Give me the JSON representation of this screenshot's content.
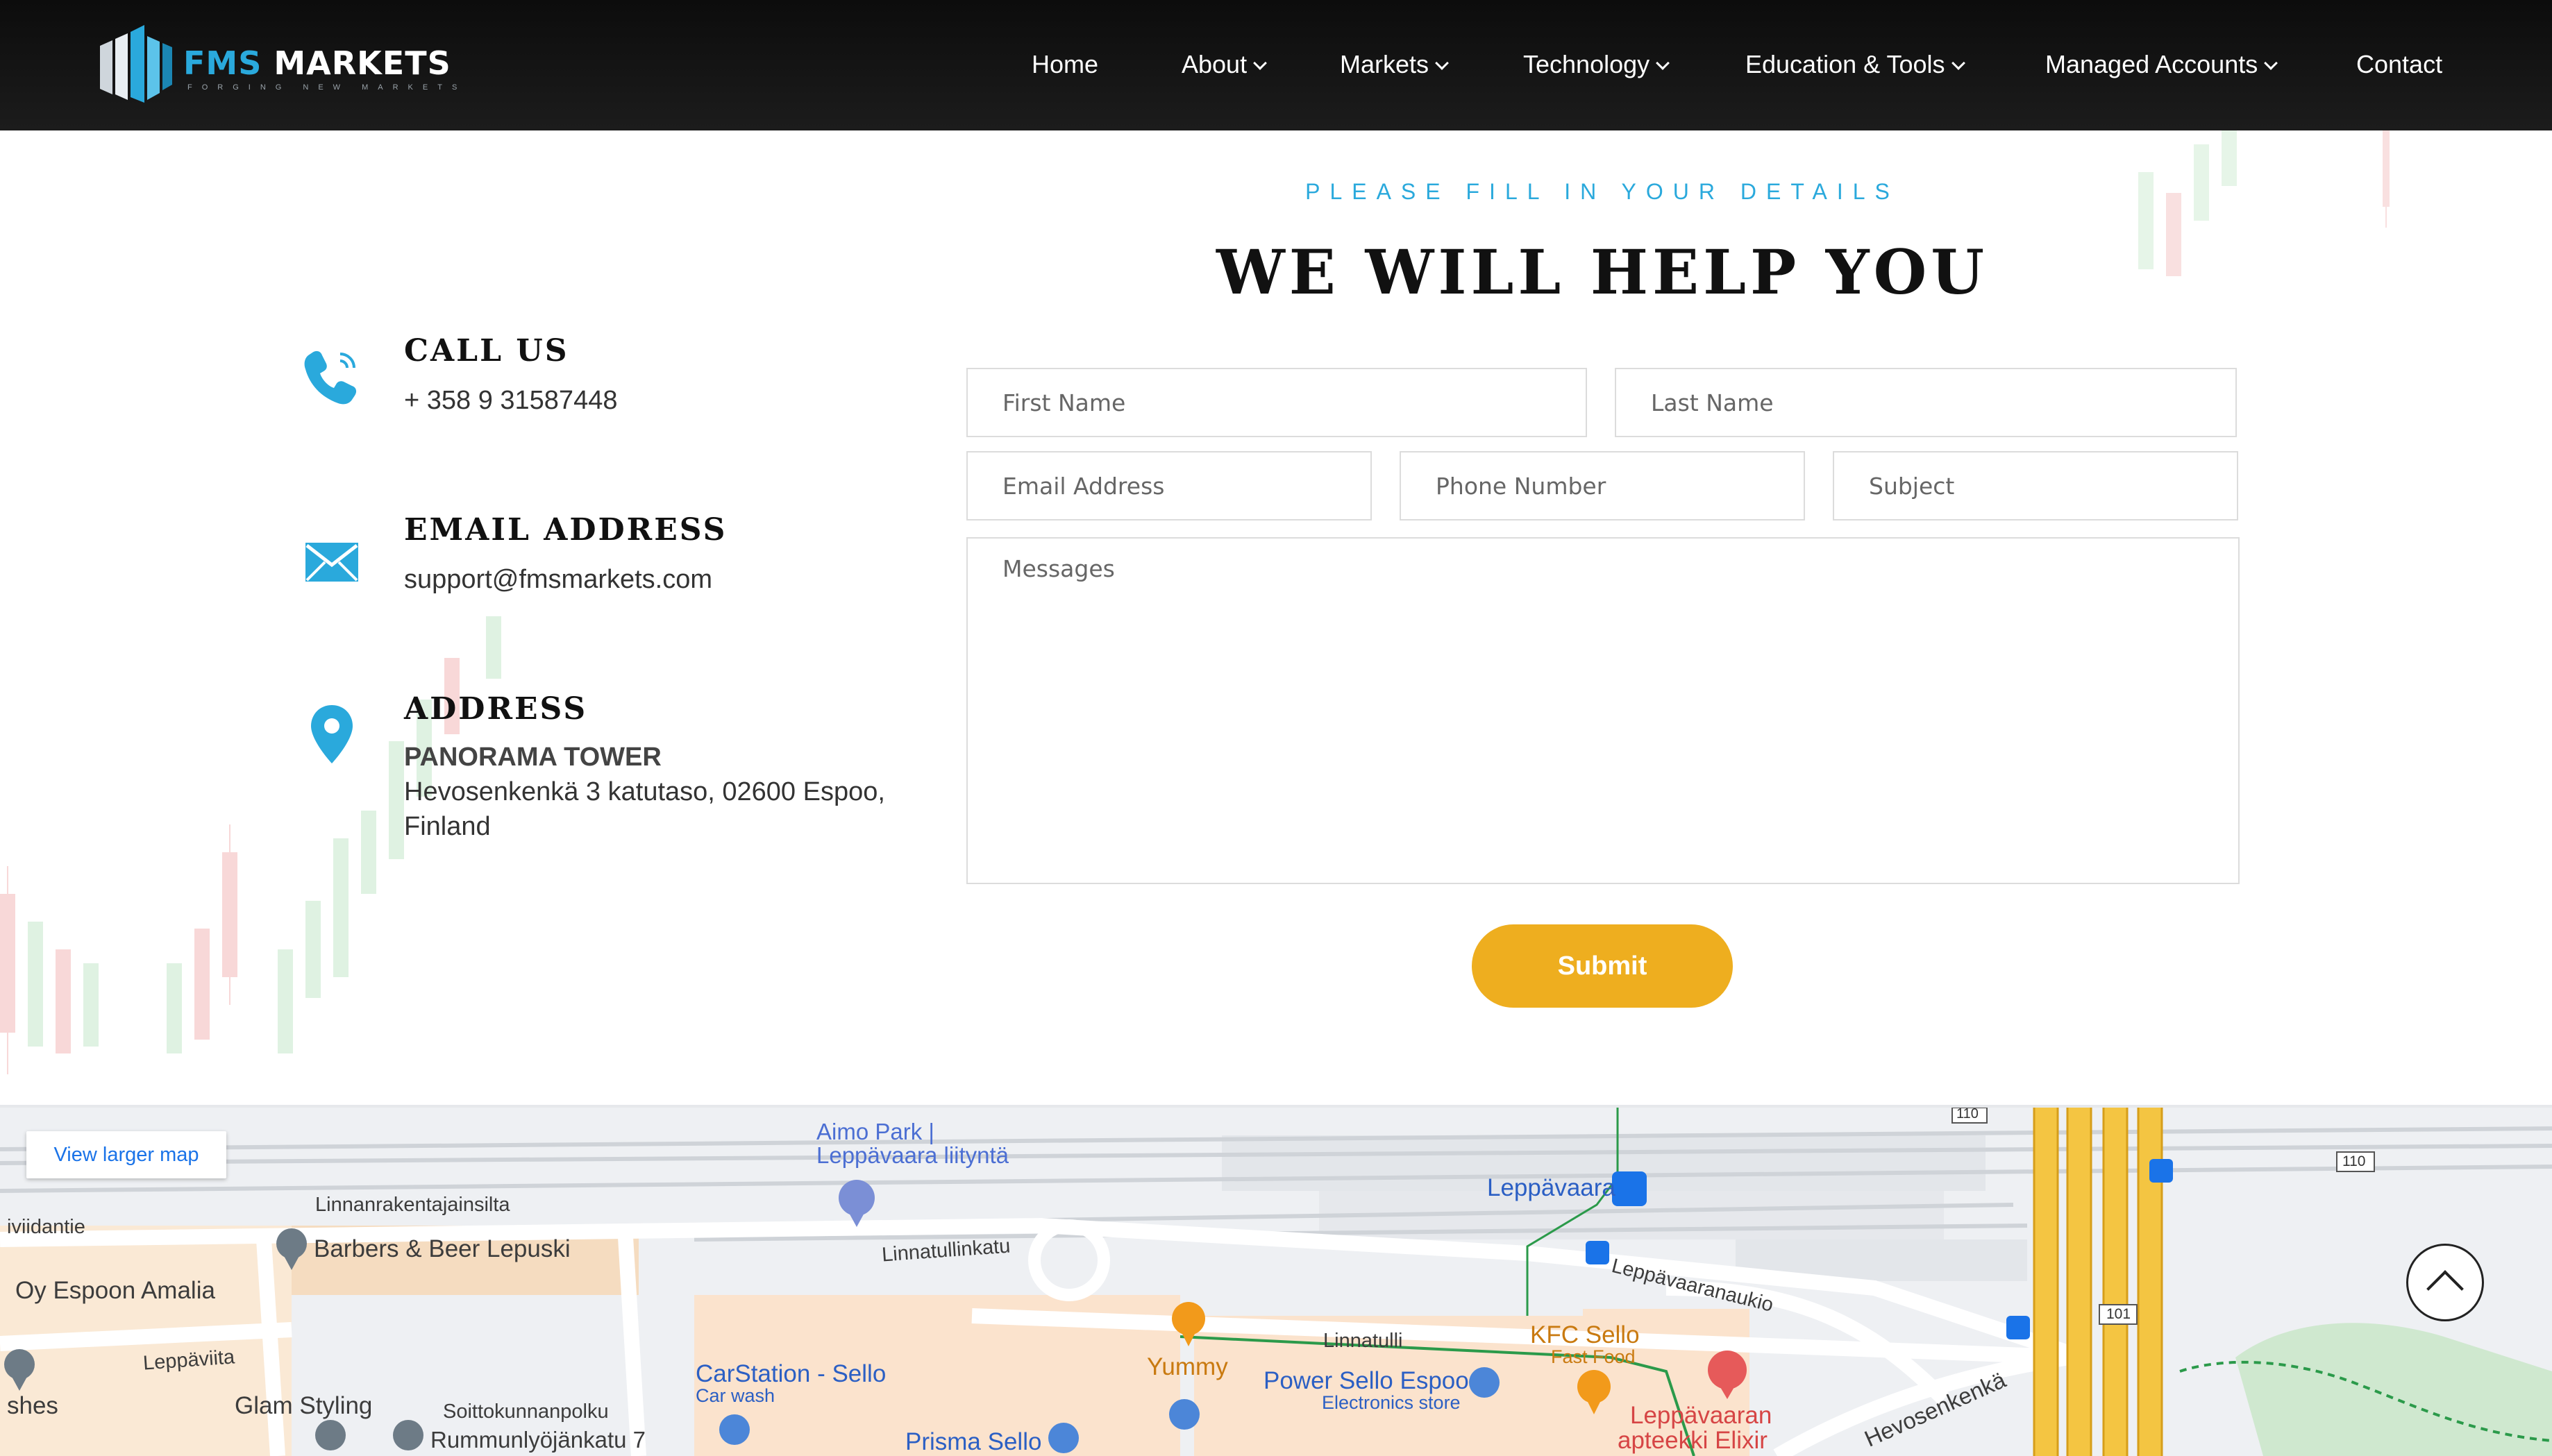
{
  "brand": {
    "name_part1": "FMS",
    "name_part2": " MARKETS",
    "tagline": "FORGING NEW MARKETS"
  },
  "nav": {
    "home": "Home",
    "about": "About",
    "markets": "Markets",
    "technology": "Technology",
    "education": "Education & Tools",
    "managed": "Managed Accounts",
    "contact": "Contact"
  },
  "contact": {
    "call_title": "CALL US",
    "phone": "+ 358 9 31587448",
    "email_title": "EMAIL ADDRESS",
    "email": "support@fmsmarkets.com",
    "address_title": "ADDRESS",
    "address_building": "PANORAMA TOWER",
    "address_line1": "Hevosenkenkä 3 katutaso, 02600 Espoo,",
    "address_line2": "Finland"
  },
  "form": {
    "kicker": "PLEASE FILL IN YOUR DETAILS",
    "headline": "WE WILL HELP YOU",
    "first_name": "First Name",
    "last_name": "Last Name",
    "email": "Email Address",
    "phone": "Phone Number",
    "subject": "Subject",
    "messages": "Messages",
    "submit": "Submit"
  },
  "map": {
    "view_larger": "View larger map",
    "labels": {
      "aimo1": "Aimo Park |",
      "aimo2": "Leppävaara liityntä",
      "linnanrak": "Linnanrakentajainsilta",
      "viidantie": "iviidantie",
      "barbers": "Barbers & Beer Lepuski",
      "amalia": "Oy Espoon Amalia",
      "linnatullinkatu": "Linnatullinkatu",
      "leppaviita": "Leppäviita",
      "shes": "shes",
      "glam": "Glam Styling",
      "soittokunnanpolku": "Soittokunnanpolku",
      "rummunlyojankatu": "Rummunlyöjänkatu 7",
      "carstation": "CarStation - Sello",
      "carwash": "Car wash",
      "prisma": "Prisma Sello",
      "leppavaara": "Leppävaara",
      "leppavaaranaukio": "Leppävaaranaukio",
      "yummy": "Yummy",
      "linnatulli": "Linnatulli",
      "kfc": "KFC Sello",
      "fastfood": "Fast Food",
      "power": "Power Sello Espoo",
      "electronics": "Electronics store",
      "apteekki1": "Leppävaaran",
      "apteekki2": "apteekki Elixir",
      "hevosenkenka": "Hevosenkenkä",
      "r110a": "110",
      "r110b": "110",
      "r101": "101"
    }
  },
  "colors": {
    "accent": "#2aa9dc",
    "submit": "#eeae1f",
    "nav_bg": "#151515"
  }
}
